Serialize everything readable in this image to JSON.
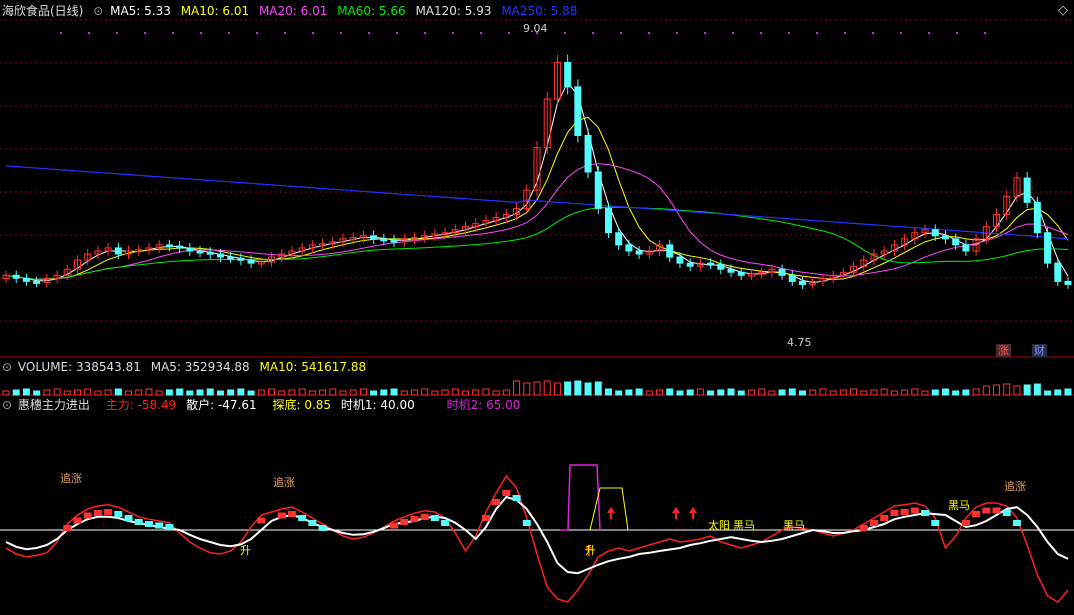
{
  "main": {
    "stock_label": "海欣食品(日线)",
    "ma": [
      {
        "label": "MA5: 5.33",
        "color": "#ffffff"
      },
      {
        "label": "MA10: 6.01",
        "color": "#ffff00"
      },
      {
        "label": "MA20: 6.01",
        "color": "#ff44ff"
      },
      {
        "label": "MA60: 5.66",
        "color": "#00ee00"
      },
      {
        "label": "MA120: 5.93",
        "color": "#dddddd"
      },
      {
        "label": "MA250: 5.88",
        "color": "#2233ff"
      }
    ],
    "high_label": "9.04",
    "low_label": "4.75",
    "badge_zhang": "涨",
    "badge_cai": "财"
  },
  "volume_header": {
    "volume": "VOLUME: 338543.81",
    "ma5": "MA5: 352934.88",
    "ma10": "MA10: 541617.88"
  },
  "indicator": {
    "name": "惠穗主力进出",
    "zhuli": "主力: -58.49",
    "sanhu": "散户: -47.61",
    "tandi": "探底: 0.85",
    "shiji1": "时机1: 40.00",
    "shiji2": "时机2: 65.00",
    "labels": {
      "zhuizhang1": "追涨",
      "zhuizhang2": "追涨",
      "zhuizhang3": "追涨",
      "sheng1": "升",
      "sheng2": "升",
      "taiyang": "太阳",
      "heima1": "黑马",
      "heima2": "黑马",
      "heima3": "黑马"
    }
  },
  "colors": {
    "up": "#ff3232",
    "down": "#54fcfc",
    "grid": "#8b0000",
    "zhuli": "#ff2020",
    "sanhu": "#ffffff",
    "tandi": "#dd22dd"
  },
  "chart_data": {
    "type": "candlestick",
    "price_range": [
      4.2,
      9.3
    ],
    "annotated_high": 9.04,
    "annotated_low": 4.75,
    "closes": [
      5.1,
      5.05,
      5.0,
      4.98,
      5.05,
      5.1,
      5.2,
      5.35,
      5.45,
      5.5,
      5.55,
      5.45,
      5.5,
      5.52,
      5.55,
      5.6,
      5.58,
      5.55,
      5.5,
      5.48,
      5.45,
      5.4,
      5.38,
      5.35,
      5.3,
      5.32,
      5.4,
      5.45,
      5.5,
      5.55,
      5.6,
      5.62,
      5.65,
      5.7,
      5.72,
      5.75,
      5.7,
      5.68,
      5.65,
      5.7,
      5.72,
      5.75,
      5.78,
      5.8,
      5.85,
      5.9,
      5.95,
      6.0,
      6.05,
      6.1,
      6.2,
      6.5,
      7.2,
      8.0,
      8.6,
      8.2,
      7.4,
      6.8,
      6.2,
      5.8,
      5.6,
      5.5,
      5.45,
      5.5,
      5.6,
      5.4,
      5.3,
      5.25,
      5.3,
      5.28,
      5.2,
      5.15,
      5.1,
      5.12,
      5.15,
      5.2,
      5.1,
      5.0,
      4.95,
      5.0,
      5.05,
      5.1,
      5.15,
      5.25,
      5.35,
      5.45,
      5.5,
      5.6,
      5.7,
      5.8,
      5.85,
      5.75,
      5.7,
      5.6,
      5.5,
      5.7,
      5.9,
      6.1,
      6.4,
      6.7,
      6.3,
      5.8,
      5.3,
      5.0,
      4.95
    ],
    "series": [
      {
        "name": "主力",
        "values": [
          -30,
          -40,
          -45,
          -42,
          -38,
          -20,
          10,
          25,
          35,
          40,
          42,
          38,
          30,
          22,
          18,
          15,
          12,
          -5,
          -20,
          -30,
          -38,
          -40,
          -35,
          -20,
          5,
          25,
          35,
          38,
          30,
          20,
          10,
          0,
          -10,
          -15,
          -12,
          -5,
          5,
          15,
          22,
          28,
          32,
          30,
          20,
          -5,
          -35,
          -10,
          30,
          62,
          90,
          70,
          20,
          -40,
          -95,
          -115,
          -120,
          -100,
          -75,
          -45,
          -35,
          -30,
          -35,
          -30,
          -25,
          -20,
          -15,
          -20,
          -18,
          -15,
          -10,
          -20,
          -25,
          -30,
          -25,
          -20,
          -10,
          0,
          5,
          0,
          -5,
          -10,
          -5,
          0,
          10,
          20,
          30,
          40,
          42,
          45,
          40,
          20,
          -30,
          -10,
          20,
          38,
          45,
          45,
          40,
          20,
          -25,
          -75,
          -110,
          -120,
          -100
        ]
      },
      {
        "name": "散户",
        "values": [
          -20,
          -28,
          -32,
          -30,
          -25,
          -15,
          0,
          10,
          18,
          22,
          22,
          20,
          15,
          8,
          5,
          2,
          0,
          -8,
          -15,
          -20,
          -25,
          -27,
          -24,
          -15,
          0,
          15,
          22,
          25,
          20,
          12,
          5,
          0,
          -5,
          -8,
          -7,
          -3,
          3,
          10,
          15,
          20,
          22,
          20,
          12,
          0,
          -15,
          5,
          35,
          55,
          50,
          35,
          10,
          -20,
          -55,
          -70,
          -72,
          -65,
          -58,
          -52,
          -48,
          -45,
          -40,
          -38,
          -35,
          -30,
          -25,
          -22,
          -18,
          -15,
          -12,
          -15,
          -18,
          -20,
          -18,
          -15,
          -10,
          -5,
          0,
          -2,
          -5,
          -5,
          -2,
          0,
          5,
          10,
          18,
          22,
          25,
          28,
          25,
          15,
          5,
          8,
          15,
          25,
          35,
          38,
          25,
          5,
          -20,
          -40,
          -48
        ]
      }
    ]
  }
}
